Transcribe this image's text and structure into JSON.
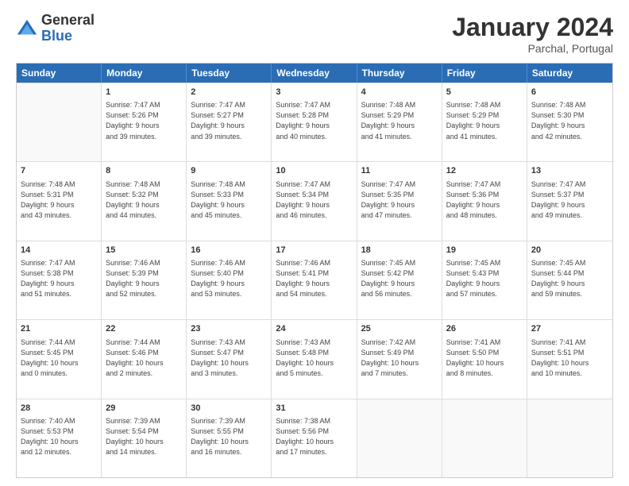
{
  "header": {
    "logo_general": "General",
    "logo_blue": "Blue",
    "main_title": "January 2024",
    "subtitle": "Parchal, Portugal"
  },
  "calendar": {
    "headers": [
      "Sunday",
      "Monday",
      "Tuesday",
      "Wednesday",
      "Thursday",
      "Friday",
      "Saturday"
    ],
    "rows": [
      [
        {
          "day": "",
          "lines": []
        },
        {
          "day": "1",
          "lines": [
            "Sunrise: 7:47 AM",
            "Sunset: 5:26 PM",
            "Daylight: 9 hours",
            "and 39 minutes."
          ]
        },
        {
          "day": "2",
          "lines": [
            "Sunrise: 7:47 AM",
            "Sunset: 5:27 PM",
            "Daylight: 9 hours",
            "and 39 minutes."
          ]
        },
        {
          "day": "3",
          "lines": [
            "Sunrise: 7:47 AM",
            "Sunset: 5:28 PM",
            "Daylight: 9 hours",
            "and 40 minutes."
          ]
        },
        {
          "day": "4",
          "lines": [
            "Sunrise: 7:48 AM",
            "Sunset: 5:29 PM",
            "Daylight: 9 hours",
            "and 41 minutes."
          ]
        },
        {
          "day": "5",
          "lines": [
            "Sunrise: 7:48 AM",
            "Sunset: 5:29 PM",
            "Daylight: 9 hours",
            "and 41 minutes."
          ]
        },
        {
          "day": "6",
          "lines": [
            "Sunrise: 7:48 AM",
            "Sunset: 5:30 PM",
            "Daylight: 9 hours",
            "and 42 minutes."
          ]
        }
      ],
      [
        {
          "day": "7",
          "lines": [
            "Sunrise: 7:48 AM",
            "Sunset: 5:31 PM",
            "Daylight: 9 hours",
            "and 43 minutes."
          ]
        },
        {
          "day": "8",
          "lines": [
            "Sunrise: 7:48 AM",
            "Sunset: 5:32 PM",
            "Daylight: 9 hours",
            "and 44 minutes."
          ]
        },
        {
          "day": "9",
          "lines": [
            "Sunrise: 7:48 AM",
            "Sunset: 5:33 PM",
            "Daylight: 9 hours",
            "and 45 minutes."
          ]
        },
        {
          "day": "10",
          "lines": [
            "Sunrise: 7:47 AM",
            "Sunset: 5:34 PM",
            "Daylight: 9 hours",
            "and 46 minutes."
          ]
        },
        {
          "day": "11",
          "lines": [
            "Sunrise: 7:47 AM",
            "Sunset: 5:35 PM",
            "Daylight: 9 hours",
            "and 47 minutes."
          ]
        },
        {
          "day": "12",
          "lines": [
            "Sunrise: 7:47 AM",
            "Sunset: 5:36 PM",
            "Daylight: 9 hours",
            "and 48 minutes."
          ]
        },
        {
          "day": "13",
          "lines": [
            "Sunrise: 7:47 AM",
            "Sunset: 5:37 PM",
            "Daylight: 9 hours",
            "and 49 minutes."
          ]
        }
      ],
      [
        {
          "day": "14",
          "lines": [
            "Sunrise: 7:47 AM",
            "Sunset: 5:38 PM",
            "Daylight: 9 hours",
            "and 51 minutes."
          ]
        },
        {
          "day": "15",
          "lines": [
            "Sunrise: 7:46 AM",
            "Sunset: 5:39 PM",
            "Daylight: 9 hours",
            "and 52 minutes."
          ]
        },
        {
          "day": "16",
          "lines": [
            "Sunrise: 7:46 AM",
            "Sunset: 5:40 PM",
            "Daylight: 9 hours",
            "and 53 minutes."
          ]
        },
        {
          "day": "17",
          "lines": [
            "Sunrise: 7:46 AM",
            "Sunset: 5:41 PM",
            "Daylight: 9 hours",
            "and 54 minutes."
          ]
        },
        {
          "day": "18",
          "lines": [
            "Sunrise: 7:45 AM",
            "Sunset: 5:42 PM",
            "Daylight: 9 hours",
            "and 56 minutes."
          ]
        },
        {
          "day": "19",
          "lines": [
            "Sunrise: 7:45 AM",
            "Sunset: 5:43 PM",
            "Daylight: 9 hours",
            "and 57 minutes."
          ]
        },
        {
          "day": "20",
          "lines": [
            "Sunrise: 7:45 AM",
            "Sunset: 5:44 PM",
            "Daylight: 9 hours",
            "and 59 minutes."
          ]
        }
      ],
      [
        {
          "day": "21",
          "lines": [
            "Sunrise: 7:44 AM",
            "Sunset: 5:45 PM",
            "Daylight: 10 hours",
            "and 0 minutes."
          ]
        },
        {
          "day": "22",
          "lines": [
            "Sunrise: 7:44 AM",
            "Sunset: 5:46 PM",
            "Daylight: 10 hours",
            "and 2 minutes."
          ]
        },
        {
          "day": "23",
          "lines": [
            "Sunrise: 7:43 AM",
            "Sunset: 5:47 PM",
            "Daylight: 10 hours",
            "and 3 minutes."
          ]
        },
        {
          "day": "24",
          "lines": [
            "Sunrise: 7:43 AM",
            "Sunset: 5:48 PM",
            "Daylight: 10 hours",
            "and 5 minutes."
          ]
        },
        {
          "day": "25",
          "lines": [
            "Sunrise: 7:42 AM",
            "Sunset: 5:49 PM",
            "Daylight: 10 hours",
            "and 7 minutes."
          ]
        },
        {
          "day": "26",
          "lines": [
            "Sunrise: 7:41 AM",
            "Sunset: 5:50 PM",
            "Daylight: 10 hours",
            "and 8 minutes."
          ]
        },
        {
          "day": "27",
          "lines": [
            "Sunrise: 7:41 AM",
            "Sunset: 5:51 PM",
            "Daylight: 10 hours",
            "and 10 minutes."
          ]
        }
      ],
      [
        {
          "day": "28",
          "lines": [
            "Sunrise: 7:40 AM",
            "Sunset: 5:53 PM",
            "Daylight: 10 hours",
            "and 12 minutes."
          ]
        },
        {
          "day": "29",
          "lines": [
            "Sunrise: 7:39 AM",
            "Sunset: 5:54 PM",
            "Daylight: 10 hours",
            "and 14 minutes."
          ]
        },
        {
          "day": "30",
          "lines": [
            "Sunrise: 7:39 AM",
            "Sunset: 5:55 PM",
            "Daylight: 10 hours",
            "and 16 minutes."
          ]
        },
        {
          "day": "31",
          "lines": [
            "Sunrise: 7:38 AM",
            "Sunset: 5:56 PM",
            "Daylight: 10 hours",
            "and 17 minutes."
          ]
        },
        {
          "day": "",
          "lines": []
        },
        {
          "day": "",
          "lines": []
        },
        {
          "day": "",
          "lines": []
        }
      ]
    ]
  }
}
